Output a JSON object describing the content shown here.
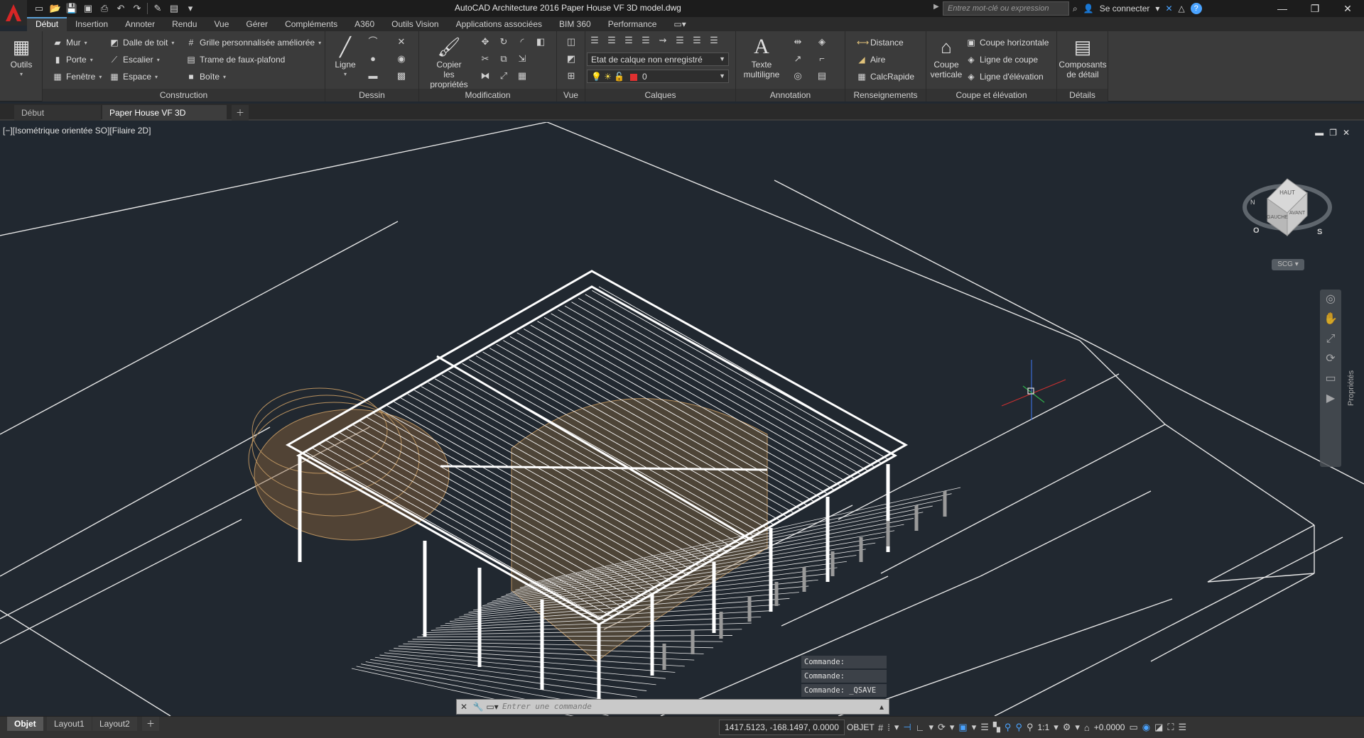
{
  "app": {
    "title": "AutoCAD Architecture 2016    Paper House VF 3D model.dwg",
    "search_placeholder": "Entrez mot-clé ou expression",
    "sign_in": "Se connecter"
  },
  "menu": {
    "tabs": [
      "Début",
      "Insertion",
      "Annoter",
      "Rendu",
      "Vue",
      "Gérer",
      "Compléments",
      "A360",
      "Outils Vision",
      "Applications associées",
      "BIM 360",
      "Performance"
    ],
    "active": "Début"
  },
  "ribbon": {
    "outils_label": "Outils",
    "construction": {
      "title": "Construction",
      "items": [
        "Mur",
        "Porte",
        "Fenêtre",
        "Dalle de toit",
        "Escalier",
        "Espace",
        "Grille personnalisée améliorée",
        "Trame de faux-plafond",
        "Boîte"
      ]
    },
    "dessin": {
      "title": "Dessin",
      "ligne": "Ligne"
    },
    "modification": {
      "title": "Modification",
      "copier_line1": "Copier",
      "copier_line2": "les propriétés"
    },
    "vue": {
      "title": "Vue"
    },
    "calques": {
      "title": "Calques",
      "layer_state": "Etat de calque non enregistré",
      "current_layer": "0"
    },
    "annotation": {
      "title": "Annotation",
      "texte_line1": "Texte",
      "texte_line2": "multiligne"
    },
    "renseignements": {
      "title": "Renseignements",
      "items": [
        "Distance",
        "Aire",
        "CalcRapide"
      ]
    },
    "coupe": {
      "title": "Coupe et élévation",
      "verticale_line1": "Coupe",
      "verticale_line2": "verticale",
      "items": [
        "Coupe horizontale",
        "Ligne de coupe",
        "Ligne d'élévation"
      ]
    },
    "details": {
      "title": "Détails",
      "composants_line1": "Composants",
      "composants_line2": "de détail"
    }
  },
  "file_tabs": {
    "start": "Début",
    "document": "Paper House VF 3D model"
  },
  "viewport": {
    "label": "[−][Isométrique orientée SO][Filaire 2D]",
    "viewcube": {
      "top": "HAUT",
      "left": "GAUCHE",
      "front": "AVANT",
      "compass_o": "O",
      "compass_s": "S",
      "compass_n": "N"
    },
    "ucs_label": "SCG",
    "properties_label": "Propriétés"
  },
  "command": {
    "history": [
      "Commande:",
      "Commande:",
      "Commande:  _QSAVE"
    ],
    "placeholder": "Entrer une commande"
  },
  "layout_tabs": [
    "Objet",
    "Layout1",
    "Layout2"
  ],
  "status": {
    "coords": "1417.5123, -168.1497, 0.0000",
    "mode": "OBJET",
    "scale": "1:1",
    "elevation": "+0.0000"
  },
  "colors": {
    "viewport_bg": "#212830",
    "wireframe": "#ffffff",
    "wood": "#b8915f",
    "layer_red": "#e03030",
    "accent_blue": "#4aa3ff"
  }
}
